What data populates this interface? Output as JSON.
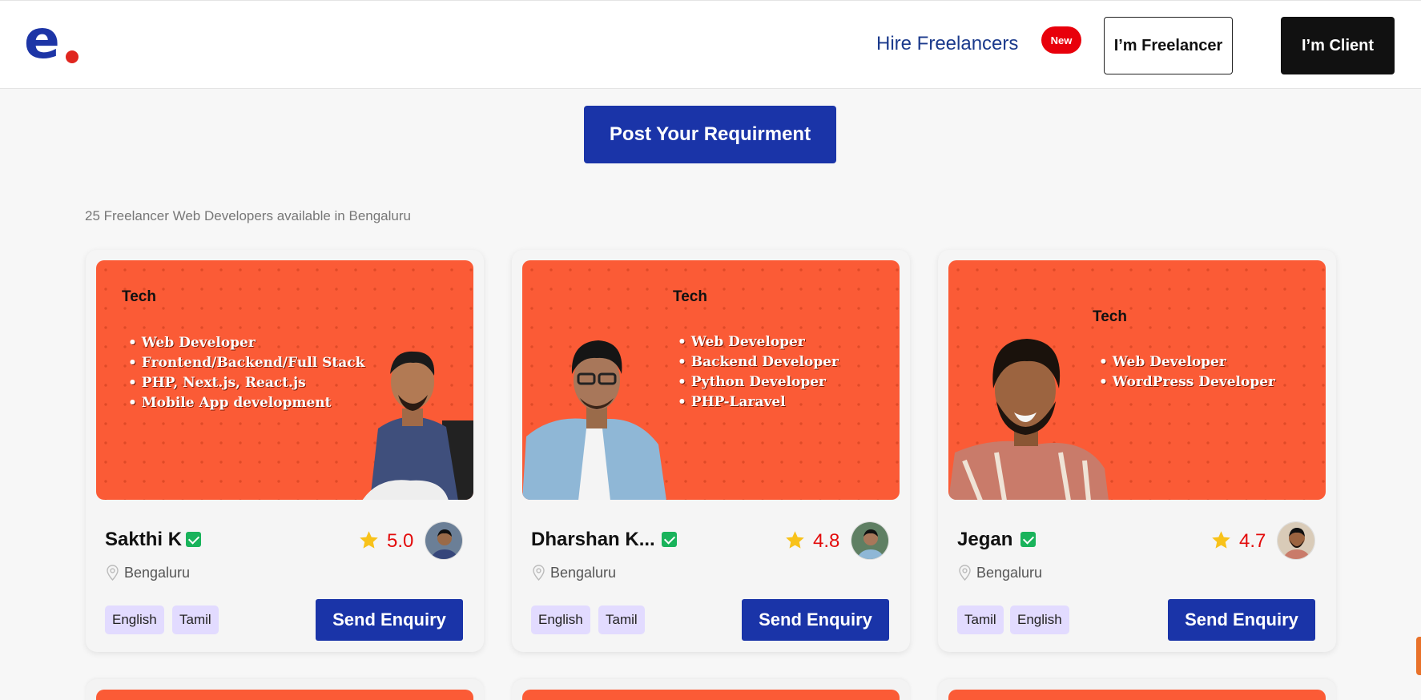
{
  "header": {
    "logo_letter": "e",
    "nav_hire": "Hire Freelancers",
    "new_badge": "New",
    "freelancer_button": "I’m Freelancer",
    "client_button": "I’m Client"
  },
  "post_requirement_label": "Post Your Requirment",
  "available_text": "25 Freelancer Web Developers available in Bengaluru",
  "colors": {
    "brand_blue": "#1a34a8",
    "banner_orange": "#fb5b36",
    "rating_red": "#e30b0b",
    "verified_green": "#19b35b",
    "tag_purple": "#e2dbff",
    "new_badge_red": "#e8000b"
  },
  "cards": [
    {
      "banner_title": "Tech",
      "banner_items": [
        "Web Developer",
        "Frontend/Backend/Full Stack",
        "PHP, Next.js, React.js",
        "Mobile App development"
      ],
      "name": "Sakthi K",
      "rating": "5.0",
      "location": "Bengaluru",
      "languages": [
        "English",
        "Tamil"
      ],
      "button": "Send Enquiry"
    },
    {
      "banner_title": "Tech",
      "banner_items": [
        "Web Developer",
        "Backend Developer",
        "Python Developer",
        "PHP-Laravel"
      ],
      "name": "Dharshan K...",
      "rating": "4.8",
      "location": "Bengaluru",
      "languages": [
        "English",
        "Tamil"
      ],
      "button": "Send Enquiry"
    },
    {
      "banner_title": "Tech",
      "banner_items": [
        "Web Developer",
        "WordPress Developer"
      ],
      "name": "Jegan",
      "rating": "4.7",
      "location": "Bengaluru",
      "languages": [
        "Tamil",
        "English"
      ],
      "button": "Send Enquiry"
    }
  ],
  "icons": {
    "verified": "verified-check-icon",
    "star": "star-icon",
    "location": "location-pin-icon"
  }
}
